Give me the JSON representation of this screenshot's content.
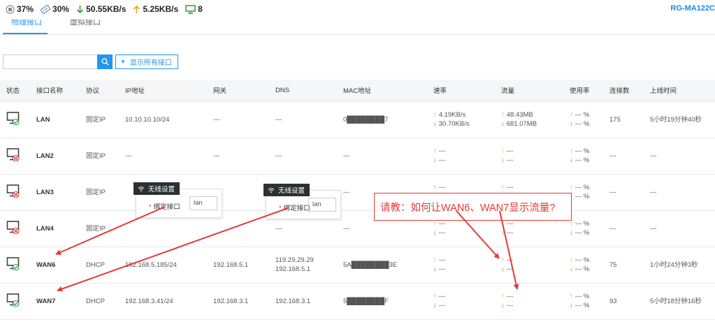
{
  "topbar": {
    "cpu": "37%",
    "memory": "30%",
    "download": "50.55KB/s",
    "upload": "5.25KB/s",
    "devices": "8",
    "model": "RG-MA122C"
  },
  "tabs": [
    {
      "label": "物理接口"
    },
    {
      "label": "虚拟接口"
    }
  ],
  "search": {
    "value": "",
    "filter_label": "显示所有接口"
  },
  "table": {
    "headers": [
      "状态",
      "接口名称",
      "协议",
      "IP地址",
      "网关",
      "DNS",
      "MAC地址",
      "速率",
      "流量",
      "使用率",
      "连接数",
      "上线时间"
    ],
    "rows": [
      {
        "status": "online",
        "name": "LAN",
        "protocol": "固定IP",
        "ip": "10.10.10.10/24",
        "gateway": "---",
        "dns1": "---",
        "dns2": "",
        "mac": "0████████7",
        "rate_up": "4.19KB/s",
        "rate_down": "30.70KB/s",
        "traffic_up": "48.43MB",
        "traffic_down": "681.07MB",
        "usage_up": "--- %",
        "usage_down": "--- %",
        "connections": "175",
        "online_time": "5小时19分钟40秒"
      },
      {
        "status": "offline",
        "name": "LAN2",
        "protocol": "固定IP",
        "ip": "---",
        "gateway": "---",
        "dns1": "---",
        "dns2": "",
        "mac": "---",
        "rate_up": "---",
        "rate_down": "---",
        "traffic_up": "---",
        "traffic_down": "---",
        "usage_up": "--- %",
        "usage_down": "--- %",
        "connections": "---",
        "online_time": "---"
      },
      {
        "status": "offline",
        "name": "LAN3",
        "protocol": "固定IP",
        "ip": "",
        "gateway": "",
        "dns1": "",
        "dns2": "",
        "mac": "---",
        "rate_up": "---",
        "rate_down": "---",
        "traffic_up": "---",
        "traffic_down": "---",
        "usage_up": "--- %",
        "usage_down": "--- %",
        "connections": "---",
        "online_time": "---"
      },
      {
        "status": "offline",
        "name": "LAN4",
        "protocol": "固定IP",
        "ip": "",
        "gateway": "",
        "dns1": "---",
        "dns2": "",
        "mac": "---",
        "rate_up": "---",
        "rate_down": "---",
        "traffic_up": "---",
        "traffic_down": "---",
        "usage_up": "--- %",
        "usage_down": "--- %",
        "connections": "---",
        "online_time": "---"
      },
      {
        "status": "online",
        "name": "WAN6",
        "protocol": "DHCP",
        "ip": "192.168.5.185/24",
        "gateway": "192.168.5.1",
        "dns1": "119.29.29.29",
        "dns2": "192.168.5.1",
        "mac": "5A████████3E",
        "rate_up": "---",
        "rate_down": "---",
        "traffic_up": "---",
        "traffic_down": "---",
        "usage_up": "--- %",
        "usage_down": "--- %",
        "connections": "75",
        "online_time": "1小时24分钟3秒"
      },
      {
        "status": "online",
        "name": "WAN7",
        "protocol": "DHCP",
        "ip": "192.168.3.41/24",
        "gateway": "192.168.3.1",
        "dns1": "192.168.3.1",
        "dns2": "",
        "mac": "5████████F",
        "rate_up": "---",
        "rate_down": "---",
        "traffic_up": "---",
        "traffic_down": "---",
        "usage_up": "--- %",
        "usage_down": "--- %",
        "connections": "93",
        "online_time": "5小时18分钟16秒"
      }
    ]
  },
  "popups": [
    {
      "title": "无线设置",
      "label": "绑定接口",
      "value": "lan"
    },
    {
      "title": "无线设置",
      "label": "绑定接口",
      "value": "lan"
    }
  ],
  "annotation": {
    "text": "请教：如何让WAN6、WAN7显示流量?"
  },
  "colors": {
    "accent": "#2196f3",
    "upload": "#f0a020",
    "download": "#2e9e3a",
    "annotation": "#e53935",
    "status_online": "#2e9e3a",
    "status_offline": "#e53935"
  },
  "icons": {
    "cpu": "chip-icon",
    "memory": "memory-icon",
    "download": "arrow-down-icon",
    "upload": "arrow-up-icon",
    "devices": "monitor-icon",
    "search": "search-icon",
    "wifi": "wifi-icon"
  }
}
